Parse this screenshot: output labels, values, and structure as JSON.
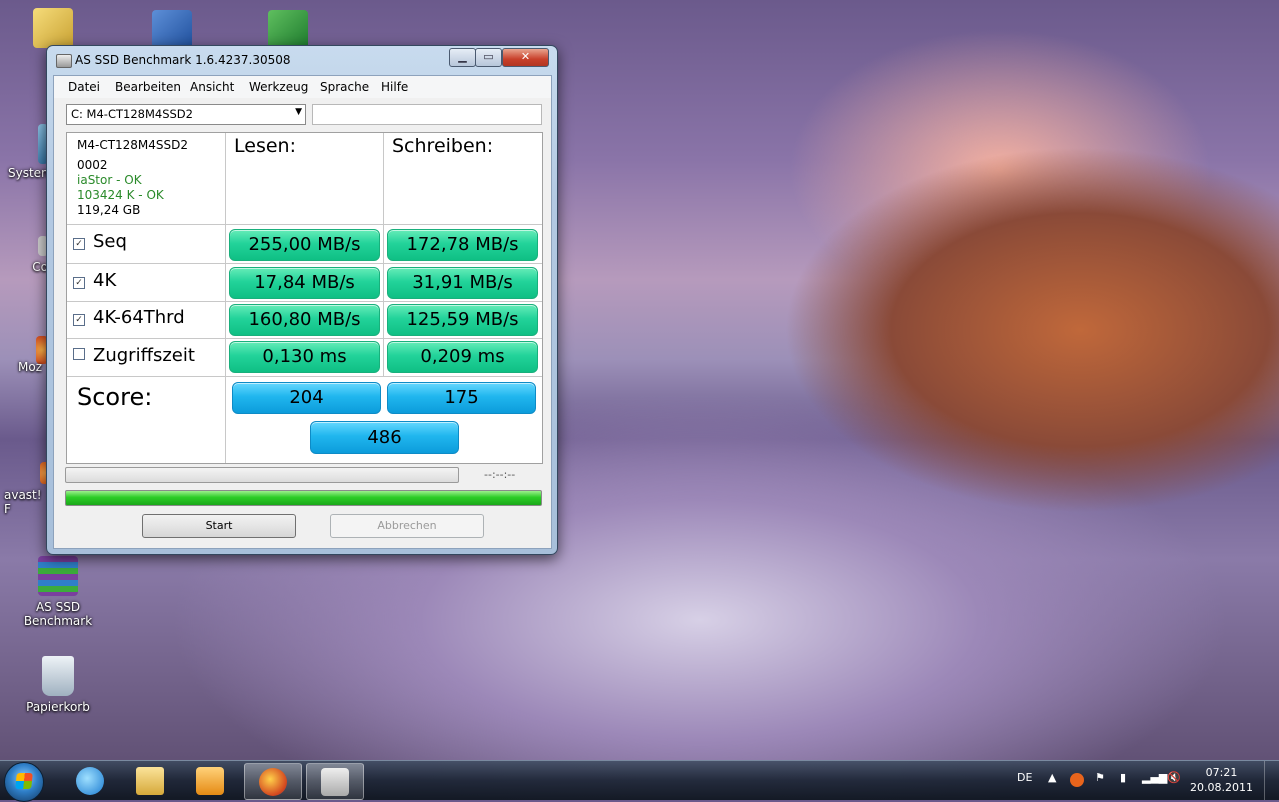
{
  "window": {
    "title": "AS SSD Benchmark 1.6.4237.30508",
    "close_label": "✕",
    "min_label": "▁",
    "max_label": "▭"
  },
  "menu": [
    "Datei",
    "Bearbeiten",
    "Ansicht",
    "Werkzeug",
    "Sprache",
    "Hilfe"
  ],
  "drive_select": {
    "value": "C: M4-CT128M4SSD2"
  },
  "drive_info": {
    "model": "M4-CT128M4SSD2",
    "firmware": "0002",
    "driver_status": "iaStor - OK",
    "alignment_status": "103424 K - OK",
    "capacity": "119,24 GB"
  },
  "columns": {
    "read": "Lesen:",
    "write": "Schreiben:"
  },
  "rows": [
    {
      "label": "Seq",
      "checked": true,
      "read": "255,00 MB/s",
      "write": "172,78 MB/s"
    },
    {
      "label": "4K",
      "checked": true,
      "read": "17,84 MB/s",
      "write": "31,91 MB/s"
    },
    {
      "label": "4K-64Thrd",
      "checked": true,
      "read": "160,80 MB/s",
      "write": "125,59 MB/s"
    },
    {
      "label": "Zugriffszeit",
      "checked": false,
      "read": "0,130 ms",
      "write": "0,209 ms"
    }
  ],
  "score": {
    "label": "Score:",
    "read": "204",
    "write": "175",
    "total": "486"
  },
  "progress": {
    "time": "--:--:--",
    "top_fill": 0.0,
    "bottom_fill": 1.0
  },
  "buttons": {
    "start": "Start",
    "cancel": "Abbrechen"
  },
  "desktop_icons": [
    {
      "label": "Systen"
    },
    {
      "label": "Co"
    },
    {
      "label": "Moz"
    },
    {
      "label": "avast! F"
    },
    {
      "label": "AS SSD Benchmark"
    },
    {
      "label": "Papierkorb"
    }
  ],
  "taskbar": {
    "language": "DE",
    "time": "07:21",
    "date": "20.08.2011"
  }
}
